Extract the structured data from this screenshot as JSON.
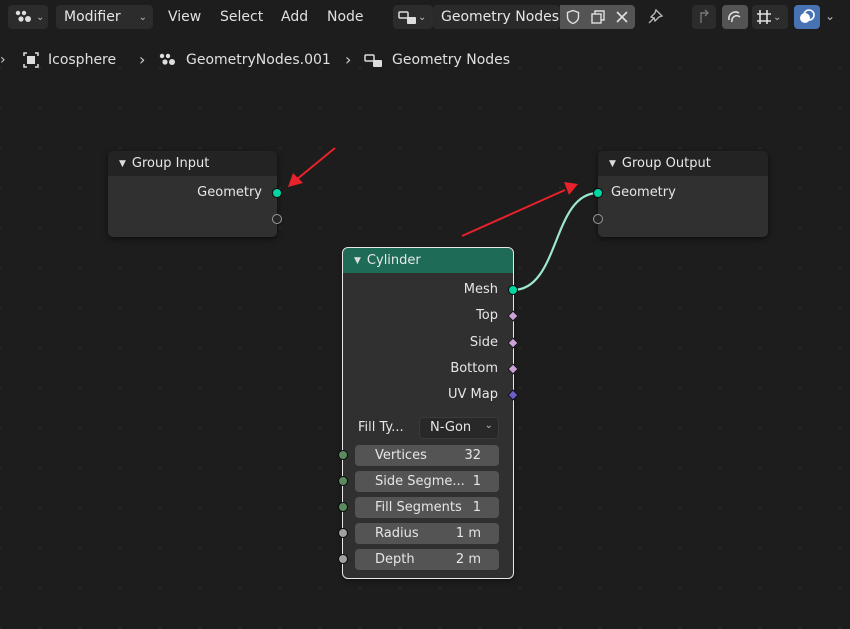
{
  "header": {
    "editor_type_icon": "node-editor-icon",
    "mode": "Modifier",
    "menus": [
      "View",
      "Select",
      "Add",
      "Node"
    ],
    "node_tree_name": "Geometry Nodes"
  },
  "breadcrumb": {
    "object": "Icosphere",
    "modifier": "GeometryNodes.001",
    "tree": "Geometry Nodes"
  },
  "nodes": {
    "group_input": {
      "title": "Group Input",
      "output": "Geometry"
    },
    "group_output": {
      "title": "Group Output",
      "input": "Geometry"
    },
    "cylinder": {
      "title": "Cylinder",
      "outputs": [
        "Mesh",
        "Top",
        "Side",
        "Bottom",
        "UV Map"
      ],
      "fill_type_label": "Fill Ty...",
      "fill_type_value": "N-Gon",
      "inputs": [
        {
          "label": "Vertices",
          "value": "32"
        },
        {
          "label": "Side Segme...",
          "value": "1"
        },
        {
          "label": "Fill Segments",
          "value": "1"
        },
        {
          "label": "Radius",
          "value": "1 m"
        },
        {
          "label": "Depth",
          "value": "2 m"
        }
      ]
    }
  },
  "colors": {
    "background": "#1d1d1d",
    "geometry_socket": "#00d6a3",
    "cylinder_header": "#1e6b58",
    "link": "#9ee6cf",
    "annotation_arrow": "#e8212b",
    "attribute_socket": "#c9a3d8",
    "vector_socket": "#6b5fc7"
  }
}
